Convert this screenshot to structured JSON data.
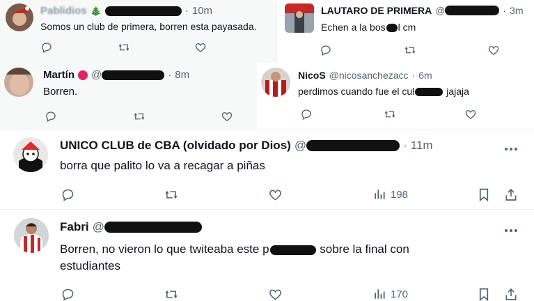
{
  "tweets": [
    {
      "name": "Pablidios",
      "handle_prefix": "",
      "time": "10m",
      "text": "Somos un club de primera, borren esta payasada.",
      "tree_emoji": "🎄"
    },
    {
      "name": "LAUTARO DE PRIMERA",
      "handle_prefix": "@",
      "time": "3m",
      "text_before": "Echen a la bos",
      "text_after": "l cm"
    },
    {
      "name": "Martín",
      "handle_prefix": "@",
      "time": "8m",
      "text": "Borren."
    },
    {
      "name": "NicoS",
      "handle": "@nicosanchezacc",
      "time": "6m",
      "text_before": "perdimos cuando fue el cul",
      "text_after": " jajaja"
    },
    {
      "name": "UNICO CLUB de CBA (olvidado por Dios)",
      "handle_prefix": "@",
      "time": "11m",
      "text": "borra que palito lo va a recagar a piñas",
      "views": "198"
    },
    {
      "name": "Fabri",
      "handle_prefix": "@",
      "time": "",
      "text_line1_before": "Borren, no vieron lo que twiteaba este p",
      "text_line1_after": " sobre la final con",
      "text_line2": "estudiantes",
      "views": "170"
    }
  ],
  "separator": "·",
  "icons": {
    "reply": "reply-icon",
    "retweet": "retweet-icon",
    "like": "heart-icon",
    "views": "views-icon",
    "bookmark": "bookmark-icon",
    "share": "share-icon",
    "more": "more-icon"
  },
  "colors": {
    "text": "#0f1419",
    "muted": "#536471",
    "panel_gray": "#f7f9f9",
    "verified_red": "#e0245e"
  }
}
